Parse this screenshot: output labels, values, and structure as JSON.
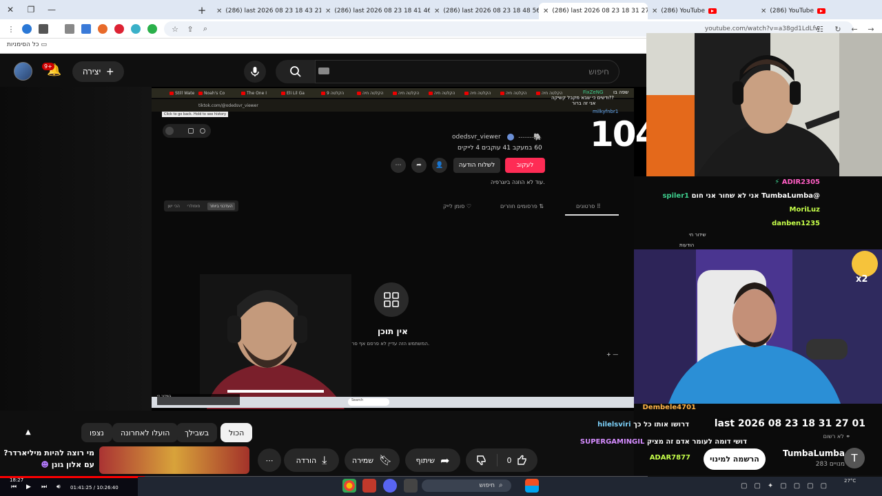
{
  "browser": {
    "tabs": [
      {
        "title": "(286) last 2026 08 23 18 43 21",
        "active": false
      },
      {
        "title": "(286) last 2026 08 23 18 41 46",
        "active": false
      },
      {
        "title": "(286) last 2026 08 23 18 48 56",
        "active": false
      },
      {
        "title": "(286) last 2026 08 23 18 31 27",
        "active": true
      },
      {
        "title": "(286) YouTube",
        "active": false
      },
      {
        "title": "(286) YouTube",
        "active": false
      }
    ],
    "url": "youtube.com/watch?v=a38gd1LdLfw",
    "bookmarks_label": "כל הסימניות"
  },
  "youtube": {
    "create_label": "יצירה",
    "notif_badge": "9+",
    "search_placeholder": "חיפוש"
  },
  "tiktok": {
    "url": "tiktok.com/@odedsvr_viewer",
    "tooltip": "Click to go back. Hold to see history",
    "username": "odedsvr_viewer",
    "display_name": "........",
    "stats": "60 במעקב   41 עוקבים   4 לייקים",
    "follow_label": "לעקוב",
    "message_label": "לשלוח הודעה",
    "bio": "עוד לא הוזנה ביוגרפיה.",
    "tabs": {
      "videos": "סרטונים",
      "reposts": "פרסומים חוזרים",
      "liked": "סומן לייק"
    },
    "sort": {
      "latest": "העדכני ביותר",
      "popular": "פופולרי",
      "oldest": "הכי ישן"
    },
    "empty_title": "אין תוכן",
    "empty_subtitle": "המשתמש הזה עדיין לא פרסם אף סרטון.",
    "inner_tabs": [
      "Still Wate",
      "Noah's Co",
      "The One I",
      "Eli Lil Ga",
      "הקלטה 9",
      "הקלטה חיה",
      "הקלטה חיה",
      "הקלטה חיה",
      "הקלטה חיה",
      "הקלטה חיה",
      "הקלטה חיה"
    ],
    "inner_search": "Search",
    "inner_vid_label": "בשידור חי"
  },
  "overlay": {
    "big_number": "104",
    "chat_top": [
      "FixZeNG",
      "שפה בו",
      "ודשים כי שבא מקבל קשיקה??",
      "אני זה ברור",
      "milkyfnbr1"
    ]
  },
  "chat": {
    "lines": [
      {
        "user": "ADIR2305",
        "text": "",
        "color": "#ff5ec4"
      },
      {
        "user": "spiler1",
        "text": "@TumbaLumba אני לא שחור אני חום",
        "color": "#3ecf8e"
      },
      {
        "user": "MoriLuz",
        "text": "",
        "color": "#c6ff4a"
      },
      {
        "user": "danben1235",
        "text": "",
        "color": "#c6ff4a"
      }
    ],
    "lower_lines": [
      {
        "user": "Dembele4701",
        "text": "",
        "color": "#ffb347"
      },
      {
        "user": "hilelsviri",
        "text": "דרושו אותו כל כך",
        "color": "#7dd3fc"
      },
      {
        "user": "SUPERGAMINGIL",
        "text": "דושי דומה לעומר אדם זה מציק",
        "color": "#d58cff"
      },
      {
        "user": "ADAR7877",
        "text": "",
        "color": "#c6ff4a"
      }
    ],
    "subtitle_small": "שידור חי",
    "notifications_small": "הודעות",
    "multiplier": "x2"
  },
  "video": {
    "watermark": "last 2026 08 23 18 31 27 01",
    "not_live": "לא רשום",
    "channel": "TumbaLumba",
    "subscribers": "283 מנויים",
    "subscribe_label": "הרשמה למינוי",
    "channel_initial": "T"
  },
  "chips": {
    "all": "הכול",
    "for_you": "בשבילך",
    "recent": "הועלו לאחרונה",
    "watched": "נצפו"
  },
  "actions": {
    "like_count": "0",
    "share": "שיתוף",
    "save": "שמירה",
    "download": "הורדה"
  },
  "promo": {
    "line1": "מי רוצה להיות מיליארדר?",
    "line2": "עם אלון גונן"
  },
  "player": {
    "time": "01:41:25 / 10:26:40",
    "clock": "18:27"
  },
  "taskbar": {
    "search": "חיפוש",
    "temp": "27°C"
  }
}
